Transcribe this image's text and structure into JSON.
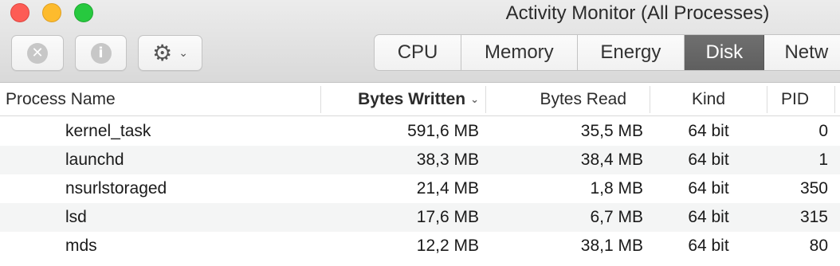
{
  "window": {
    "title": "Activity Monitor (All Processes)"
  },
  "toolbar": {
    "stop_icon": "x-circle-icon",
    "stop_glyph": "✕",
    "info_icon": "info-icon",
    "info_glyph": "i",
    "gear_icon": "gear-icon",
    "gear_glyph": "⚙",
    "chevron_glyph": "⌄"
  },
  "tabs": [
    {
      "label": "CPU",
      "selected": false
    },
    {
      "label": "Memory",
      "selected": false
    },
    {
      "label": "Energy",
      "selected": false
    },
    {
      "label": "Disk",
      "selected": true
    },
    {
      "label": "Netw",
      "selected": false
    }
  ],
  "table": {
    "columns": {
      "name": "Process Name",
      "written": "Bytes Written",
      "read": "Bytes Read",
      "kind": "Kind",
      "pid": "PID"
    },
    "sort_glyph": "⌄",
    "rows": [
      {
        "name": "kernel_task",
        "written": "591,6 MB",
        "read": "35,5 MB",
        "kind": "64 bit",
        "pid": "0"
      },
      {
        "name": "launchd",
        "written": "38,3 MB",
        "read": "38,4 MB",
        "kind": "64 bit",
        "pid": "1"
      },
      {
        "name": "nsurlstoraged",
        "written": "21,4 MB",
        "read": "1,8 MB",
        "kind": "64 bit",
        "pid": "350"
      },
      {
        "name": "lsd",
        "written": "17,6 MB",
        "read": "6,7 MB",
        "kind": "64 bit",
        "pid": "315"
      },
      {
        "name": "mds",
        "written": "12,2 MB",
        "read": "38,1 MB",
        "kind": "64 bit",
        "pid": "80"
      }
    ]
  },
  "colors": {
    "close": "#fd5c55",
    "minimize": "#fdbb2d",
    "zoom": "#27c93f",
    "selected_tab": "#666666"
  }
}
